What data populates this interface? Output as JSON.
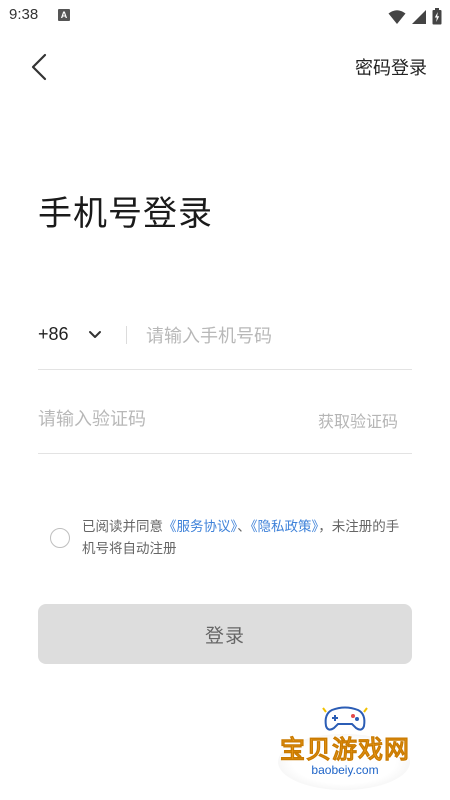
{
  "status_bar": {
    "time": "9:38",
    "notification_badge": "A",
    "icons": [
      "wifi-icon",
      "signal-icon",
      "battery-charging-icon"
    ]
  },
  "header": {
    "back_icon": "chevron-left-icon",
    "password_login_label": "密码登录"
  },
  "page_title": "手机号登录",
  "phone": {
    "country_code": "+86",
    "placeholder": "请输入手机号码",
    "value": ""
  },
  "code": {
    "placeholder": "请输入验证码",
    "value": "",
    "get_code_label": "获取验证码"
  },
  "agreement": {
    "prefix": "已阅读并同意",
    "service_link": "《服务协议》",
    "separator": "、",
    "privacy_link": "《隐私政策》",
    "suffix": "，未注册的手机号将自动注册",
    "checked": false
  },
  "login_button_label": "登录",
  "colors": {
    "link": "#3f82d9",
    "button_bg": "#dddddd",
    "placeholder": "#b8b8b8"
  },
  "watermark": {
    "title": "宝贝游戏网",
    "url": "baobeiy.com"
  }
}
